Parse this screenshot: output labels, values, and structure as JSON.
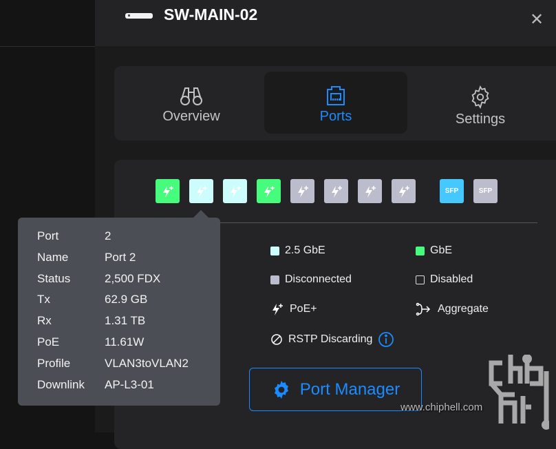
{
  "header": {
    "title": "SW-MAIN-02",
    "device_icon": "switch-icon",
    "close_icon": "close-icon"
  },
  "tabs": [
    {
      "label": "Overview",
      "icon": "binoculars-icon"
    },
    {
      "label": "Ports",
      "icon": "ethernet-port-icon",
      "active": true
    },
    {
      "label": "Settings",
      "icon": "gear-icon"
    }
  ],
  "ports": [
    {
      "number": 1,
      "state": "GbE",
      "color": "#45fc7c"
    },
    {
      "number": 2,
      "state": "2.5 GbE",
      "color": "#ccfcfc"
    },
    {
      "number": 3,
      "state": "2.5 GbE",
      "color": "#ccfcfc"
    },
    {
      "number": 4,
      "state": "GbE",
      "color": "#45fc7c"
    },
    {
      "number": 5,
      "state": "Disconnected",
      "color": "#bbbdcc"
    },
    {
      "number": 6,
      "state": "Disconnected",
      "color": "#bbbdcc"
    },
    {
      "number": 7,
      "state": "Disconnected",
      "color": "#bbbdcc"
    },
    {
      "number": 8,
      "state": "Disconnected",
      "color": "#bbbdcc"
    }
  ],
  "sfp_ports": [
    {
      "label": "SFP",
      "color": "#44c8ff"
    },
    {
      "label": "SFP",
      "color": "#bbbdcc"
    }
  ],
  "legend": {
    "gbe25": "2.5 GbE",
    "gbe": "GbE",
    "disconnected": "Disconnected",
    "disabled": "Disabled",
    "poe": "PoE+",
    "aggregate": "Aggregate",
    "rstp": "RSTP Discarding"
  },
  "colors": {
    "gbe25": "#ccfcfc",
    "gbe": "#45fc7c",
    "disconnected": "#bbbdcc",
    "accent": "#1a8cff"
  },
  "port_manager_label": "Port Manager",
  "tooltip": [
    {
      "k": "Port",
      "v": "2"
    },
    {
      "k": "Name",
      "v": "Port 2"
    },
    {
      "k": "Status",
      "v": "2,500 FDX"
    },
    {
      "k": "Tx",
      "v": "62.9 GB"
    },
    {
      "k": "Rx",
      "v": "1.31 TB"
    },
    {
      "k": "PoE",
      "v": "11.61W"
    },
    {
      "k": "Profile",
      "v": "VLAN3toVLAN2"
    },
    {
      "k": "Downlink",
      "v": "AP-L3-01"
    }
  ],
  "watermark": {
    "url": "www.chiphell.com",
    "logo": "chiphell"
  }
}
